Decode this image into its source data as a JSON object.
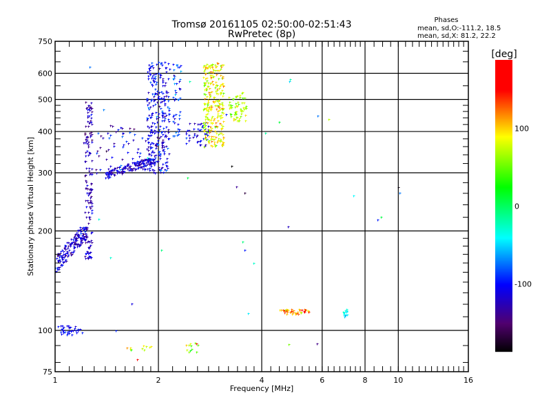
{
  "chart_data": {
    "type": "scatter",
    "title": "Tromsø 20161105 02:50:00-02:51:43",
    "subtitle": "RwPretec (8p)",
    "stats": {
      "heading": "Phases",
      "o_line": "mean, sd,O:-111.2, 18.5",
      "x_line": "mean, sd,X:  81.2, 22.2"
    },
    "xlabel": "Frequency [MHz]",
    "ylabel": "Stationary phase Virtual Height [km]",
    "xscale": "log",
    "yscale": "log",
    "xlim": [
      1,
      16
    ],
    "ylim": [
      75,
      750
    ],
    "xticks": [
      1,
      2,
      4,
      6,
      8,
      10,
      16
    ],
    "xtick_labels": [
      "1",
      "2",
      "4",
      "6",
      "8",
      "10",
      "16"
    ],
    "yticks": [
      75,
      100,
      200,
      300,
      400,
      500,
      600,
      750
    ],
    "ytick_labels": [
      "75",
      "100",
      "200",
      "300",
      "400",
      "500",
      "600",
      "750"
    ],
    "grid": true,
    "colorbar": {
      "label": "[deg]",
      "range": [
        -187,
        188
      ],
      "ticks": [
        100,
        0,
        -100
      ],
      "tick_labels": [
        "100",
        "0",
        "-100"
      ]
    },
    "point_clusters": [
      {
        "name": "o-trace-low",
        "f": [
          1.0,
          1.24
        ],
        "h": [
          148,
          205
        ],
        "slope": true,
        "phase": -115,
        "sd": 15,
        "n": 160
      },
      {
        "name": "o-spike",
        "f": [
          1.22,
          1.28
        ],
        "h": [
          165,
          500
        ],
        "phase": -125,
        "sd": 14,
        "n": 150
      },
      {
        "name": "o-base",
        "f": [
          1.4,
          1.95
        ],
        "h": [
          288,
          330
        ],
        "slope": true,
        "phase": -120,
        "sd": 14,
        "n": 150
      },
      {
        "name": "o-cusp",
        "f": [
          1.85,
          2.15
        ],
        "h": [
          300,
          650
        ],
        "phase": -105,
        "sd": 16,
        "n": 260
      },
      {
        "name": "o-scatter",
        "f": [
          1.3,
          2.0
        ],
        "h": [
          300,
          420
        ],
        "phase": -115,
        "sd": 25,
        "n": 70
      },
      {
        "name": "o-upper-line",
        "f": [
          2.2,
          2.32
        ],
        "h": [
          380,
          650
        ],
        "phase": -90,
        "sd": 20,
        "n": 45
      },
      {
        "name": "o-mid",
        "f": [
          2.4,
          2.8
        ],
        "h": [
          360,
          430
        ],
        "phase": -110,
        "sd": 15,
        "n": 45
      },
      {
        "name": "x-main",
        "f": [
          2.7,
          3.1
        ],
        "h": [
          360,
          650
        ],
        "phase": 90,
        "sd": 20,
        "n": 260
      },
      {
        "name": "x-side",
        "f": [
          3.2,
          3.6
        ],
        "h": [
          430,
          530
        ],
        "phase": 70,
        "sd": 15,
        "n": 60
      },
      {
        "name": "e-layer",
        "f": [
          1.02,
          1.2
        ],
        "h": [
          97,
          104
        ],
        "phase": -105,
        "sd": 12,
        "n": 35
      },
      {
        "name": "es-echo",
        "f": [
          4.5,
          5.5
        ],
        "h": [
          112,
          116
        ],
        "phase": 110,
        "sd": 25,
        "n": 45
      },
      {
        "name": "es-echo-2",
        "f": [
          6.9,
          7.1
        ],
        "h": [
          110,
          116
        ],
        "phase": -40,
        "sd": 8,
        "n": 15
      },
      {
        "name": "low-echo-1",
        "f": [
          1.6,
          1.9
        ],
        "h": [
          87,
          90
        ],
        "phase": 90,
        "sd": 25,
        "n": 10
      },
      {
        "name": "low-echo-2",
        "f": [
          2.4,
          2.6
        ],
        "h": [
          86,
          92
        ],
        "phase": 70,
        "sd": 30,
        "n": 12
      },
      {
        "name": "noise",
        "f": [
          1.2,
          10.5
        ],
        "h": [
          80,
          650
        ],
        "phase": -60,
        "sd": 90,
        "n": 35
      }
    ]
  }
}
